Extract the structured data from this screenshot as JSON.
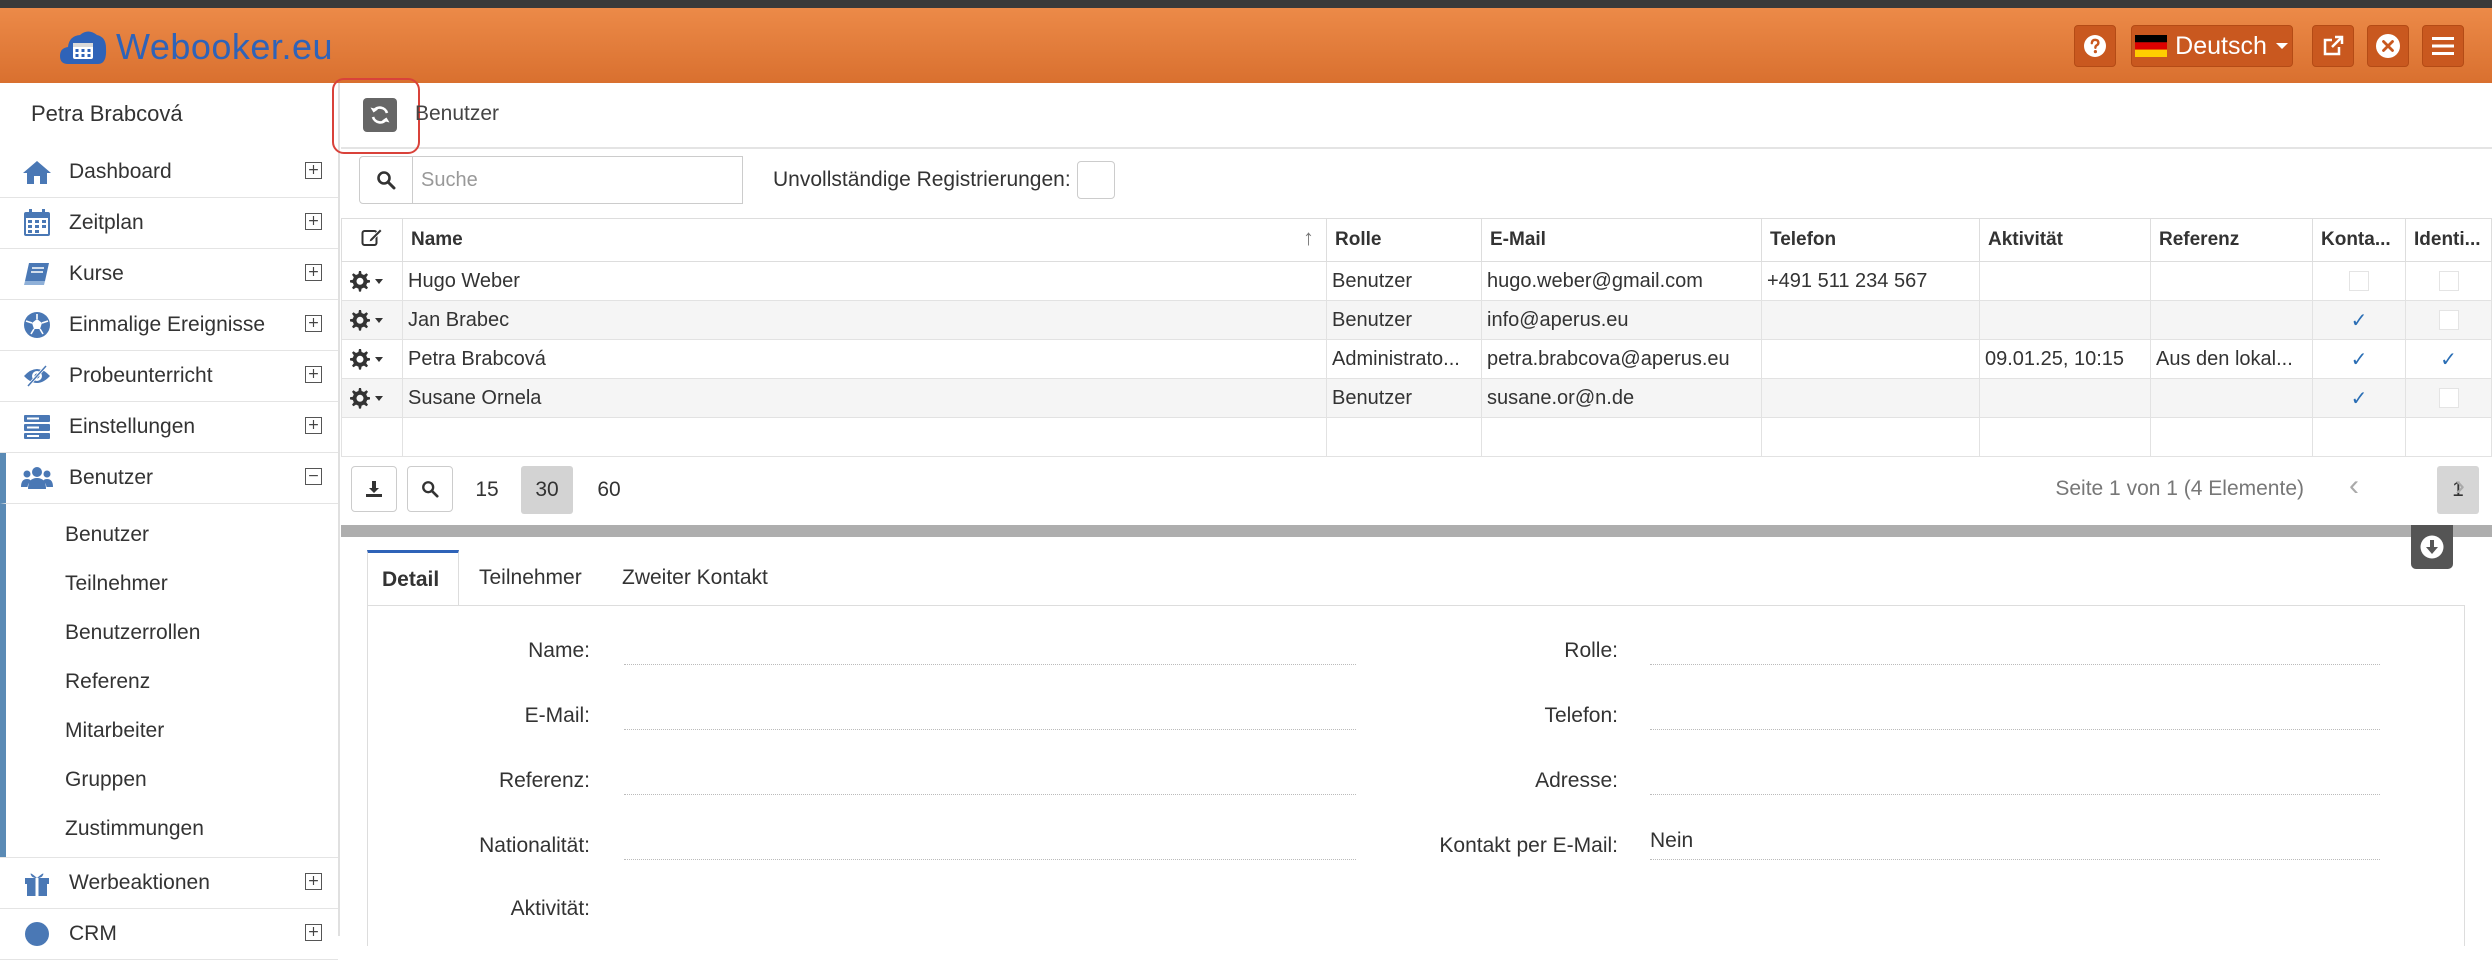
{
  "header": {
    "logo_text": "Webooker.eu",
    "language": "Deutsch",
    "help_icon": "question-circle-icon",
    "external_icon": "external-link-icon",
    "close_icon": "close-circle-icon",
    "menu_icon": "hamburger-icon",
    "colors": {
      "accent": "#e07b3c",
      "brand": "#2f63b8"
    }
  },
  "sidebar": {
    "user_name": "Petra Brabcová",
    "items": [
      {
        "label": "Dashboard",
        "icon": "home-icon"
      },
      {
        "label": "Zeitplan",
        "icon": "calendar-icon"
      },
      {
        "label": "Kurse",
        "icon": "book-icon"
      },
      {
        "label": "Einmalige Ereignisse",
        "icon": "soccer-ball-icon"
      },
      {
        "label": "Probeunterricht",
        "icon": "eye-slash-icon"
      },
      {
        "label": "Einstellungen",
        "icon": "server-icon"
      },
      {
        "label": "Benutzer",
        "icon": "users-icon"
      }
    ],
    "subitems": [
      "Benutzer",
      "Teilnehmer",
      "Benutzerrollen",
      "Referenz",
      "Mitarbeiter",
      "Gruppen",
      "Zustimmungen"
    ],
    "after_items": [
      {
        "label": "Werbeaktionen",
        "icon": "gift-icon"
      },
      {
        "label": "CRM",
        "icon": "crm-icon"
      }
    ]
  },
  "toolbar": {
    "breadcrumb": "Benutzer"
  },
  "filter": {
    "search_placeholder": "Suche",
    "incomplete_label": "Unvollständige Registrierungen:"
  },
  "table": {
    "columns": [
      "Name",
      "Rolle",
      "E-Mail",
      "Telefon",
      "Aktivität",
      "Referenz",
      "Konta...",
      "Identi..."
    ],
    "rows": [
      {
        "name": "Hugo Weber",
        "role": "Benutzer",
        "email": "hugo.weber@gmail.com",
        "phone": "+491 511 234 567",
        "activity": "",
        "reference": "",
        "contact": false,
        "identity": false
      },
      {
        "name": "Jan Brabec",
        "role": "Benutzer",
        "email": "info@aperus.eu",
        "phone": "",
        "activity": "",
        "reference": "",
        "contact": true,
        "identity": false
      },
      {
        "name": "Petra Brabcová",
        "role": "Administrato...",
        "email": "petra.brabcova@aperus.eu",
        "phone": "",
        "activity": "09.01.25, 10:15",
        "reference": "Aus den lokal...",
        "contact": true,
        "identity": true
      },
      {
        "name": "Susane Ornela",
        "role": "Benutzer",
        "email": "susane.or@n.de",
        "phone": "",
        "activity": "",
        "reference": "",
        "contact": true,
        "identity": false
      }
    ]
  },
  "pager": {
    "sizes": [
      "15",
      "30",
      "60"
    ],
    "active_size": "30",
    "info": "Seite 1 von 1 (4 Elemente)",
    "current_page": "1"
  },
  "detail": {
    "tabs": [
      "Detail",
      "Teilnehmer",
      "Zweiter Kontakt"
    ],
    "fields": {
      "name_label": "Name:",
      "email_label": "E-Mail:",
      "reference_label": "Referenz:",
      "nationality_label": "Nationalität:",
      "activity_label": "Aktivität:",
      "role_label": "Rolle:",
      "phone_label": "Telefon:",
      "address_label": "Adresse:",
      "contact_email_label": "Kontakt per E-Mail:",
      "contact_email_value": "Nein"
    }
  }
}
